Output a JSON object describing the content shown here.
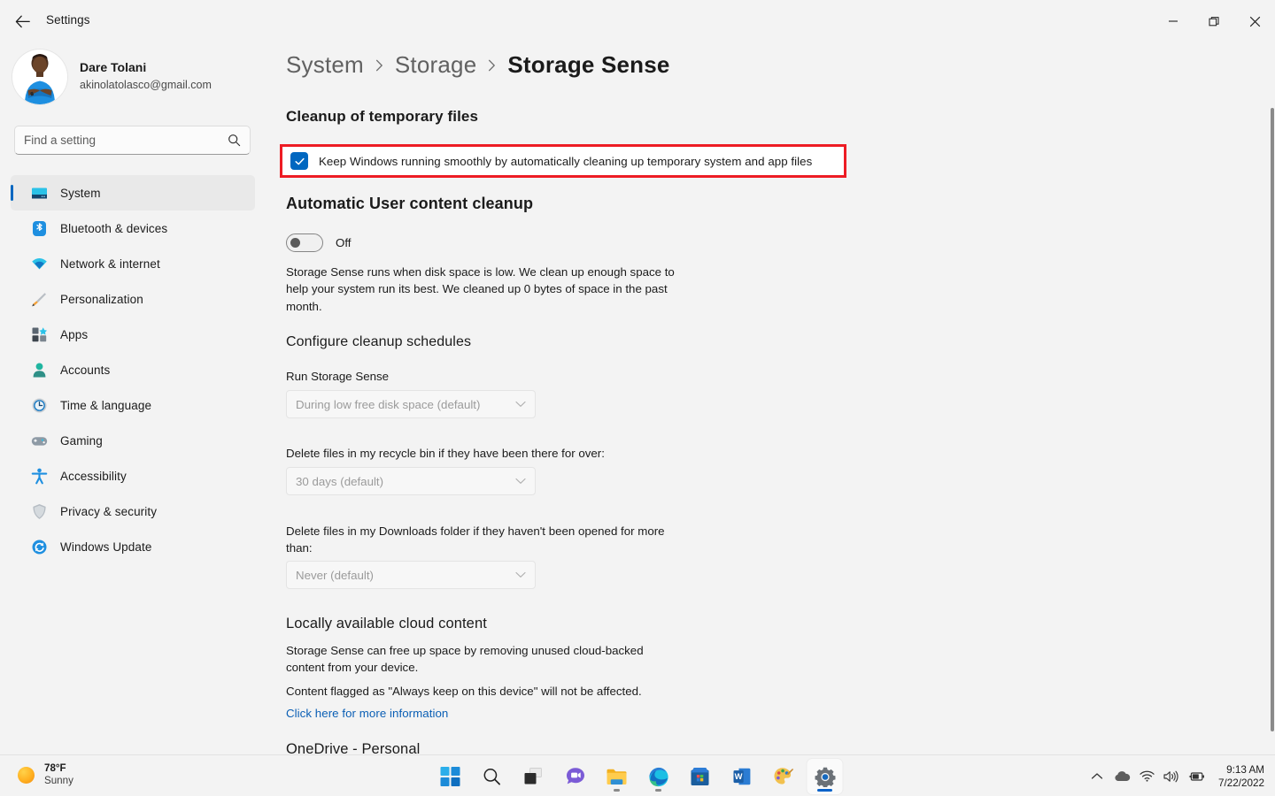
{
  "window": {
    "title": "Settings",
    "back_icon": "arrow-left-icon",
    "minimize_label": "Minimize",
    "maximize_label": "Restore",
    "close_label": "Close"
  },
  "profile": {
    "name": "Dare Tolani",
    "email": "akinolatolasco@gmail.com"
  },
  "search": {
    "placeholder": "Find a setting",
    "icon": "search-icon"
  },
  "sidebar": {
    "items": [
      {
        "label": "System",
        "icon": "monitor-icon",
        "active": true
      },
      {
        "label": "Bluetooth & devices",
        "icon": "bluetooth-icon",
        "active": false
      },
      {
        "label": "Network & internet",
        "icon": "wifi-icon",
        "active": false
      },
      {
        "label": "Personalization",
        "icon": "paintbrush-icon",
        "active": false
      },
      {
        "label": "Apps",
        "icon": "apps-grid-icon",
        "active": false
      },
      {
        "label": "Accounts",
        "icon": "person-icon",
        "active": false
      },
      {
        "label": "Time & language",
        "icon": "clock-icon",
        "active": false
      },
      {
        "label": "Gaming",
        "icon": "gamepad-icon",
        "active": false
      },
      {
        "label": "Accessibility",
        "icon": "accessibility-icon",
        "active": false
      },
      {
        "label": "Privacy & security",
        "icon": "shield-icon",
        "active": false
      },
      {
        "label": "Windows Update",
        "icon": "update-refresh-icon",
        "active": false
      }
    ]
  },
  "breadcrumb": {
    "items": [
      "System",
      "Storage",
      "Storage Sense"
    ],
    "separator": "›"
  },
  "main": {
    "cleanup_heading": "Cleanup of temporary files",
    "cleanup_checkbox": {
      "label": "Keep Windows running smoothly by automatically cleaning up temporary system and app files",
      "checked": true,
      "highlight_color": "#ED1C24",
      "accent_color": "#0067C0"
    },
    "auto_cleanup_heading": "Automatic User content cleanup",
    "toggle": {
      "state_label": "Off",
      "on": false
    },
    "toggle_description": "Storage Sense runs when disk space is low. We clean up enough space to help your system run its best. We cleaned up 0 bytes of space in the past month.",
    "schedules_heading": "Configure cleanup schedules",
    "fields": [
      {
        "label": "Run Storage Sense",
        "value": "During low free disk space (default)",
        "chevron": "chevron-down-icon"
      },
      {
        "label": "Delete files in my recycle bin if they have been there for over:",
        "value": "30 days (default)",
        "chevron": "chevron-down-icon"
      },
      {
        "label": "Delete files in my Downloads folder if they haven't been opened for more than:",
        "value": "Never (default)",
        "chevron": "chevron-down-icon"
      }
    ],
    "cloud_heading": "Locally available cloud content",
    "cloud_p1": "Storage Sense can free up space by removing unused cloud-backed content from your device.",
    "cloud_p2": "Content flagged as \"Always keep on this device\" will not be affected.",
    "cloud_link": "Click here for more information",
    "onedrive_heading": "OneDrive - Personal"
  },
  "taskbar": {
    "weather": {
      "temperature": "78°F",
      "condition": "Sunny",
      "icon": "sun-icon"
    },
    "apps": [
      {
        "name": "start-icon",
        "running": false,
        "active": false
      },
      {
        "name": "search-icon",
        "running": false,
        "active": false
      },
      {
        "name": "task-view-icon",
        "running": false,
        "active": false
      },
      {
        "name": "chat-icon",
        "running": false,
        "active": false
      },
      {
        "name": "file-explorer-icon",
        "running": true,
        "active": false
      },
      {
        "name": "edge-icon",
        "running": true,
        "active": false
      },
      {
        "name": "microsoft-store-icon",
        "running": false,
        "active": false
      },
      {
        "name": "word-icon",
        "running": false,
        "active": false
      },
      {
        "name": "paint-icon",
        "running": false,
        "active": false
      },
      {
        "name": "settings-icon",
        "running": true,
        "active": true
      }
    ],
    "tray": [
      "chevron-up-icon",
      "onedrive-cloud-icon",
      "wifi-icon",
      "volume-icon",
      "battery-icon"
    ],
    "clock": {
      "time": "9:13 AM",
      "date": "7/22/2022"
    }
  }
}
